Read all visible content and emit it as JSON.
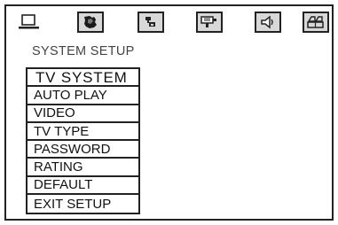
{
  "toolbar": {
    "icons": [
      {
        "name": "general-setup-icon"
      },
      {
        "name": "speaker-setup-icon"
      },
      {
        "name": "audio-setup-icon"
      },
      {
        "name": "video-setup-icon"
      },
      {
        "name": "audio-output-icon"
      },
      {
        "name": "preference-icon"
      }
    ]
  },
  "section": {
    "title": "SYSTEM SETUP"
  },
  "menu": {
    "items": [
      {
        "label": "TV SYSTEM"
      },
      {
        "label": "AUTO PLAY"
      },
      {
        "label": "VIDEO"
      },
      {
        "label": "TV TYPE"
      },
      {
        "label": "PASSWORD"
      },
      {
        "label": "RATING"
      },
      {
        "label": "DEFAULT"
      },
      {
        "label": "EXIT SETUP"
      }
    ],
    "selected": "TV SYSTEM"
  }
}
